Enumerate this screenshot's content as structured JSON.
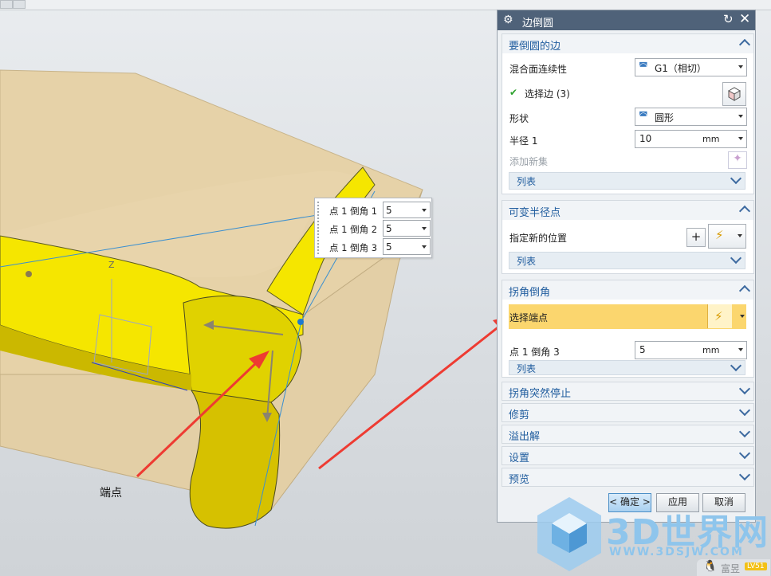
{
  "annotation": {
    "endpoint_label": "端点"
  },
  "popup": {
    "rows": [
      {
        "label": "点 1 倒角 1",
        "value": "5"
      },
      {
        "label": "点 1 倒角 2",
        "value": "5"
      },
      {
        "label": "点 1 倒角 3",
        "value": "5"
      }
    ]
  },
  "dialog": {
    "title": "边倒圆",
    "section_edges": {
      "title": "要倒圆的边",
      "continuity_label": "混合面连续性",
      "continuity_value": "G1（相切）",
      "select_edge_label": "选择边 (3)",
      "shape_label": "形状",
      "shape_value": "圆形",
      "radius_label": "半径 1",
      "radius_value": "10",
      "radius_unit": "mm",
      "add_set_label": "添加新集",
      "list_label": "列表"
    },
    "section_variable": {
      "title": "可变半径点",
      "specify_label": "指定新的位置",
      "list_label": "列表"
    },
    "section_corner": {
      "title": "拐角倒角",
      "select_endpoint_label": "选择端点",
      "point_label": "点 1 倒角 3",
      "point_value": "5",
      "point_unit": "mm",
      "list_label": "列表"
    },
    "collapsed_sections": [
      "拐角突然停止",
      "修剪",
      "溢出解",
      "设置",
      "预览"
    ],
    "buttons": {
      "ok": "< 确定 >",
      "apply": "应用",
      "cancel": "取消"
    }
  },
  "colors": {
    "fillet_yellow": "#f5e600",
    "block_tan": "#e6d2a8",
    "arrow_red": "#ee3b32",
    "title_bar": "#4f6279",
    "highlight_row": "#fbd66e"
  },
  "watermark": {
    "brand": "3D世界网",
    "url": "WWW.3DSJW.COM",
    "user": "富昱",
    "badge": "LV51"
  },
  "icons": [
    "gear-icon",
    "reset-icon",
    "close-icon",
    "checkmark-icon",
    "cube-select-icon",
    "point-dialog-icon",
    "snap-point-icon",
    "chevron-up-icon",
    "chevron-down-icon"
  ]
}
